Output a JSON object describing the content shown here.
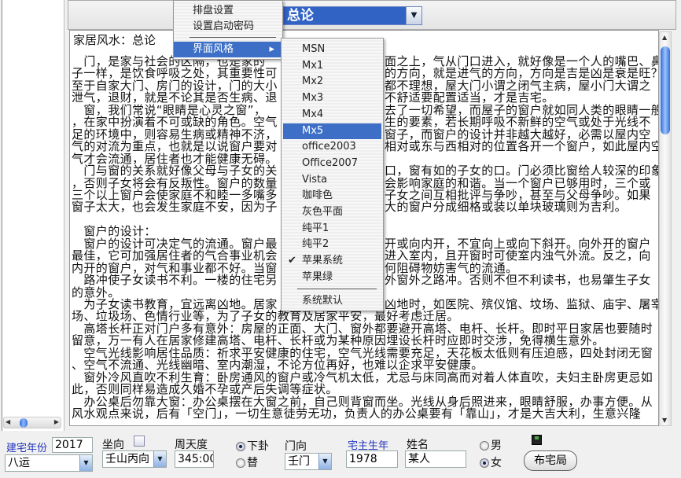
{
  "colors": {
    "accent": "#3d6fc6",
    "label_blue": "#2233bb"
  },
  "combo": {
    "value": "总论"
  },
  "menu": {
    "items": [
      "排盘设置",
      "设置启动密码",
      "界面风格"
    ],
    "submenu_arrow": "▸"
  },
  "submenu": {
    "items": [
      "MSN",
      "Mx1",
      "Mx2",
      "Mx3",
      "Mx4",
      "Mx5",
      "office2003",
      "Office2007",
      "Vista",
      "咖啡色",
      "灰色平面",
      "纯平1",
      "纯平2",
      "苹果系统",
      "苹果绿",
      "系统默认"
    ],
    "selected": "Mx5",
    "checked": "苹果系统"
  },
  "doc": {
    "title": "家居风水：总论",
    "lines": [
      [
        "　门，是家与社会的区隔，也是家的",
        "面之上，气从门口进入，就好像是一个人的嘴巴、鼻"
      ],
      [
        "子一样，是饮食呼吸之处，其重要性可",
        "的方向，就是进气的方向，方向是吉是凶是衰是旺？"
      ],
      [
        "至于自家大门、房门的设计，门的大小",
        "都不理想，屋大门小谓之闭气主病，屋小门大谓之"
      ],
      [
        "泄气，退财，就是不论其是否生病、退",
        "不舒适要配置适当，才是吉宅。"
      ],
      [
        "　窗，我们常说“眼睛是心灵之窗”，",
        "去了一切希望，而屋子的窗户就如同人类的眼睛一般"
      ],
      [
        "，在家中扮演着不可或缺的角色。空气",
        "生的要素，若长期呼吸不新鲜的空气或处于光线不"
      ],
      [
        "足的环境中，则容易生病或精神不济，",
        "窗子，而窗户的设计并非越大越好，必需以屋内空"
      ],
      [
        "气的对流为重点，也就是以说窗户要对",
        "相对或东与西相对的位置各开一个窗户，如此屋内空"
      ],
      [
        "气才会流通，居住者也才能健康无碍。",
        ""
      ],
      [
        "　门与窗的关系就好像父母与子女的关",
        "口，窗有如的子女的口。门必须比窗给人较深的印象"
      ],
      [
        "，否则子女将会有反叛性。窗户的数量",
        "会影响家庭的和谐。当一个窗户已够用时，三个或"
      ],
      [
        "三个以上窗户会使家庭不和睦一多嘴多",
        "子女之间互相批评与争吵，甚至与父母争吵。如果"
      ],
      [
        "窗子太大，也会发生家庭不安，因为子",
        "大的窗户分成细格或装以单块玻璃则为吉利。"
      ],
      [
        "",
        ""
      ],
      [
        "　窗户的设计：",
        ""
      ],
      [
        "　窗户的设计可决定气的流通。窗户最",
        "开或向内开，不宜向上或向下斜开。向外开的窗户"
      ],
      [
        "最佳，它可加强居住者的气合事业机会",
        "进入室内，且开窗时可使室内浊气外流。反之，向"
      ],
      [
        "内开的窗户，对气和事业都不好。当窗",
        "何阻碍物妨害气的流通。"
      ],
      [
        "　路冲使子女读书不利。一楼的住宅另",
        "外窗外之路冲。否则不但不利读书，也易肇生子女"
      ],
      [
        "的意外。",
        ""
      ],
      [
        "　为子女读书教育，宜远离凶地。居家",
        "凶地时，如医院、殡仪馆、坟场、监狱、庙宇、屠宰"
      ],
      [
        "场、垃圾场、色情行业等，为了子女的教育及居家平安，最好考虑迁居。",
        ""
      ],
      [
        "　高塔长杆正对门户多有意外：房屋的正面、大门、窗外都要避开高塔、电杆、长杆。即时平日家居也要随时",
        ""
      ],
      [
        "留意，万一有人在居家修建高塔、电杆、长杆或为某种原因埋设长杆时应即时交涉，免得横生意外。",
        ""
      ],
      [
        "　空气光线影响居住品质：祈求平安健康的住宅，空气光线需要充足，天花板太低则有压迫感，四处封闭无窗",
        ""
      ],
      [
        "、空气不流通、光线幽暗、室内潮湿，不论方位再好，也难以企求平安健康。",
        ""
      ],
      [
        "　窗外冷风直吹不利生育：卧房通风的窗户或冷气机太低，尤忌与床同高而对着人体直吹，夫妇主卧房更忌如",
        ""
      ],
      [
        "此，否则同样易造成久婚不孕或产后失调等症状。",
        ""
      ],
      [
        "　办公桌后勿靠大窗：办公桌摆在大窗之前，自己则背窗而坐。光线从身后照进来，眼睛舒服，办事方便。从",
        ""
      ],
      [
        "风水观点来说，后有「空门」，一切生意徒劳无功，负责人的办公桌要有「靠山」，才是大吉大利，生意兴隆",
        ""
      ]
    ]
  },
  "vscroll_position": 0.0,
  "form": {
    "build_year_label": "建宅年份",
    "build_year": "2017",
    "yun": "八运",
    "zuoxiang_label": "坐向",
    "zuoxiang": "壬山丙向",
    "zhoutiandu_label": "周天度",
    "zhoutiandu": "345:00",
    "radio_xiagua": "下卦",
    "radio_tigua": "替",
    "xiagua_selected": true,
    "menxiang_label": "门向",
    "menxiang": "壬门",
    "owner_year_label": "宅主生年",
    "owner_year": "1978",
    "name_label": "姓名",
    "name": "某人",
    "male": "男",
    "female": "女",
    "gender_selected": "女",
    "submit": "布宅局"
  }
}
